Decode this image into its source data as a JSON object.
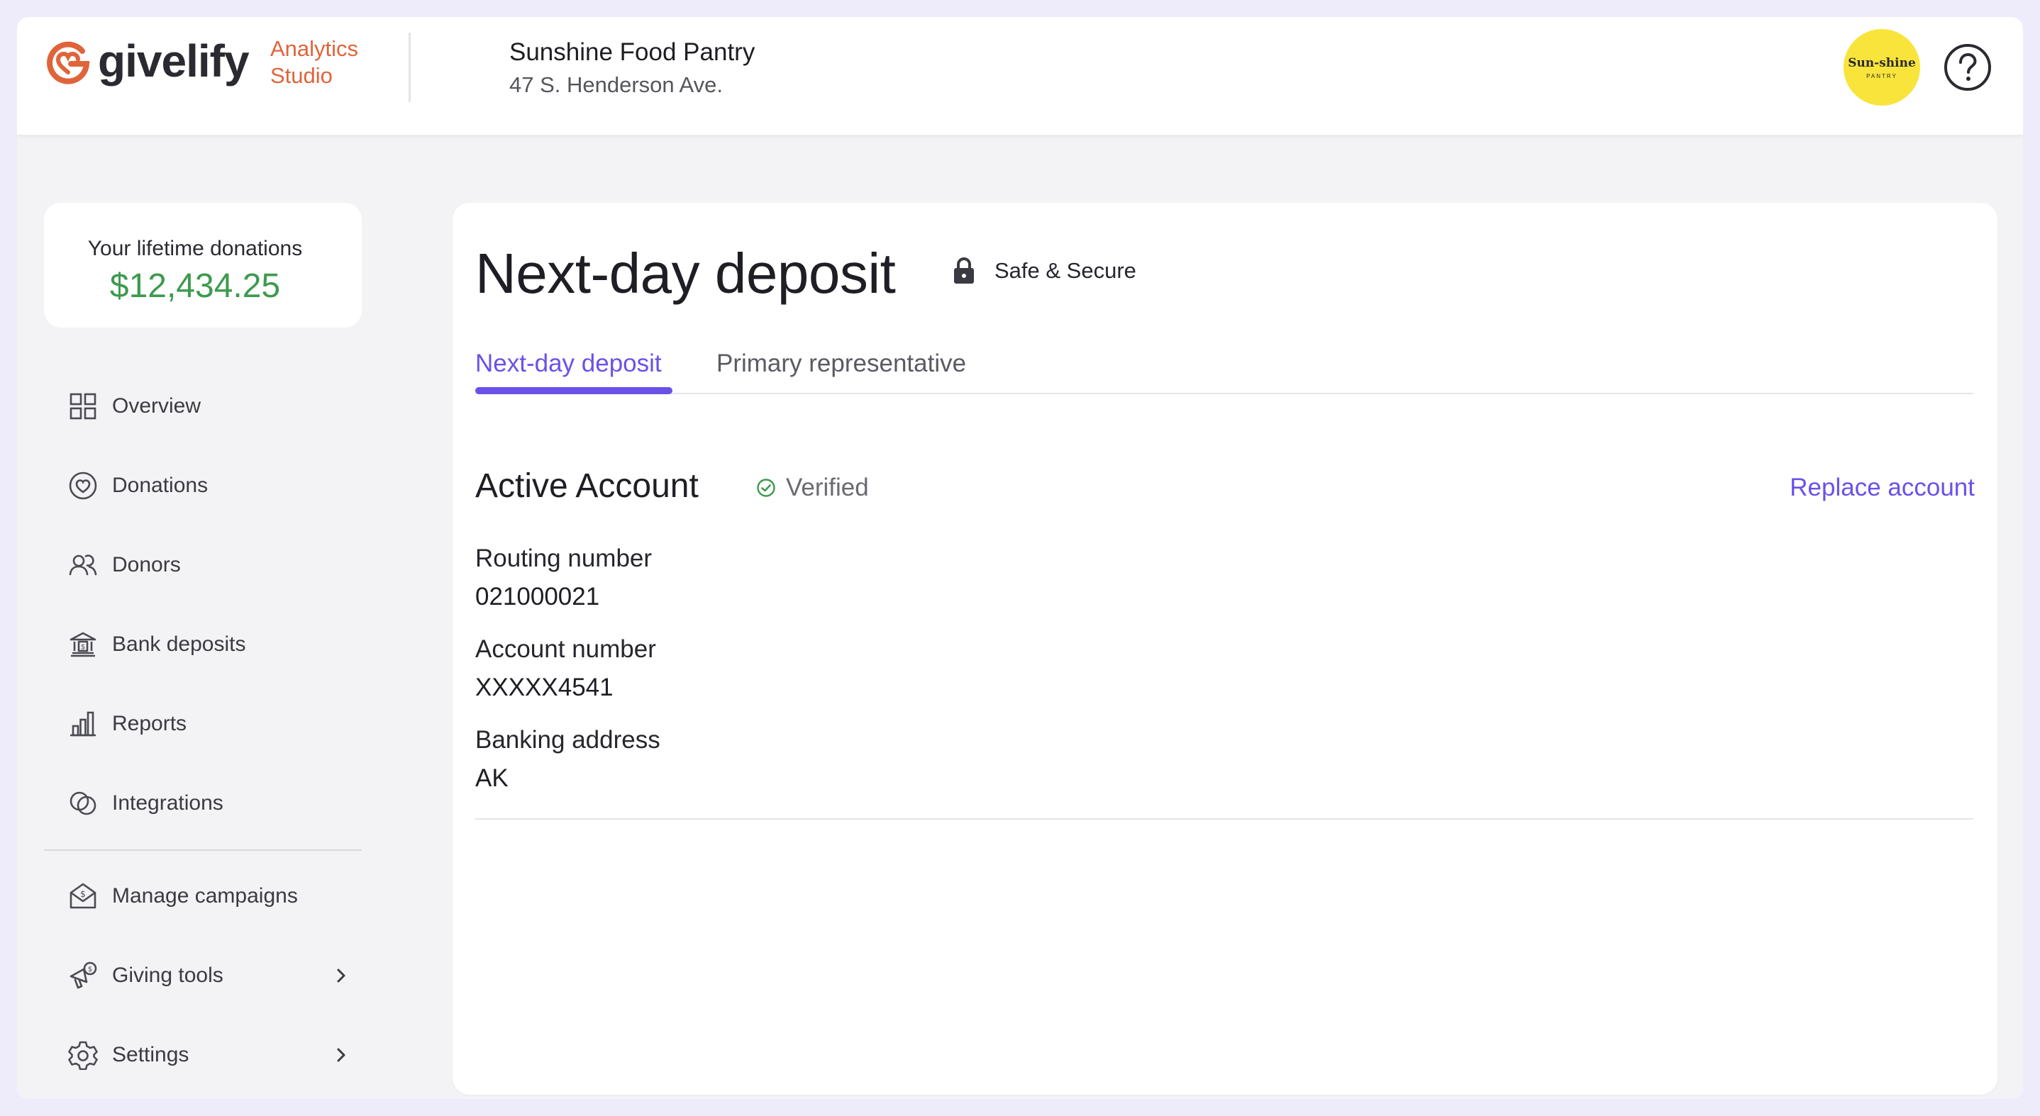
{
  "header": {
    "brand": "givelify",
    "product_line1": "Analytics",
    "product_line2": "Studio",
    "org_name": "Sunshine Food Pantry",
    "org_address": "47 S. Henderson Ave.",
    "avatar_line1": "Sun-shine",
    "avatar_line2": "PANTRY",
    "help_icon": "help-circle-icon"
  },
  "sidebar": {
    "lifetime_label": "Your lifetime donations",
    "lifetime_amount": "$12,434.25",
    "items": [
      {
        "label": "Overview",
        "icon": "grid-icon"
      },
      {
        "label": "Donations",
        "icon": "heart-circle-icon"
      },
      {
        "label": "Donors",
        "icon": "people-icon"
      },
      {
        "label": "Bank deposits",
        "icon": "bank-icon"
      },
      {
        "label": "Reports",
        "icon": "bar-chart-icon"
      },
      {
        "label": "Integrations",
        "icon": "link-icon"
      },
      {
        "label": "Manage campaigns",
        "icon": "envelope-dollar-icon"
      },
      {
        "label": "Giving tools",
        "icon": "megaphone-icon"
      },
      {
        "label": "Settings",
        "icon": "gear-icon"
      }
    ]
  },
  "main": {
    "title": "Next-day deposit",
    "secure_label": "Safe & Secure",
    "tabs": [
      {
        "label": "Next-day deposit",
        "active": true
      },
      {
        "label": "Primary representative",
        "active": false
      }
    ],
    "section_title": "Active Account",
    "verified_label": "Verified",
    "replace_label": "Replace account",
    "fields": [
      {
        "label": "Routing number",
        "value": "021000021"
      },
      {
        "label": "Account number",
        "value": "XXXXX4541"
      },
      {
        "label": "Banking address",
        "value": "AK"
      }
    ]
  },
  "colors": {
    "accent": "#6b51e8",
    "brand_orange": "#e0643a",
    "money_green": "#3d9a4e",
    "avatar_yellow": "#f9e43c",
    "page_bg": "#eeecfa"
  }
}
